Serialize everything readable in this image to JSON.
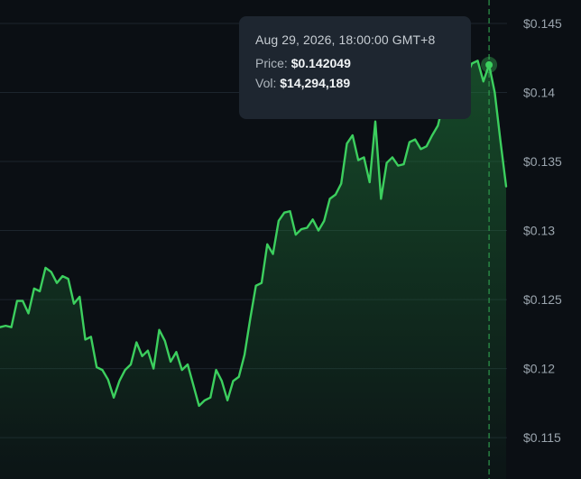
{
  "colors": {
    "background": "#0b0f14",
    "line": "#3ccf5e",
    "area_top": "#1f7a3a",
    "grid": "#1d252d",
    "tooltip_bg": "#1e2630",
    "crosshair": "#2f9a4c"
  },
  "tooltip": {
    "date": "Aug 29, 2026, 18:00:00 GMT+8",
    "price_label": "Price:",
    "price_value": "$0.142049",
    "vol_label": "Vol:",
    "vol_value": "$14,294,189"
  },
  "chart_data": {
    "type": "area",
    "ylim": [
      0.112,
      0.1467
    ],
    "y_ticks": [
      0.115,
      0.12,
      0.125,
      0.13,
      0.135,
      0.14,
      0.145
    ],
    "y_tick_labels": [
      "$0.115",
      "$0.12",
      "$0.125",
      "$0.13",
      "$0.135",
      "$0.14",
      "$0.145"
    ],
    "grid": true,
    "highlight_index": 86,
    "series": [
      {
        "values": [
          0.123,
          0.1231,
          0.123,
          0.1249,
          0.1249,
          0.124,
          0.1258,
          0.1256,
          0.1273,
          0.127,
          0.1262,
          0.1267,
          0.1265,
          0.1247,
          0.1252,
          0.1221,
          0.1223,
          0.1201,
          0.1199,
          0.1192,
          0.1179,
          0.1191,
          0.1199,
          0.1203,
          0.1219,
          0.1209,
          0.1213,
          0.12,
          0.1228,
          0.122,
          0.1205,
          0.1212,
          0.1199,
          0.1203,
          0.1188,
          0.1173,
          0.1177,
          0.1179,
          0.1199,
          0.1191,
          0.1177,
          0.1191,
          0.1194,
          0.121,
          0.1236,
          0.126,
          0.1262,
          0.129,
          0.1283,
          0.1307,
          0.1313,
          0.1314,
          0.1297,
          0.1301,
          0.1302,
          0.1308,
          0.13,
          0.1307,
          0.1323,
          0.1326,
          0.1334,
          0.1363,
          0.1369,
          0.1351,
          0.1353,
          0.1335,
          0.1379,
          0.1323,
          0.1349,
          0.1353,
          0.1347,
          0.1348,
          0.1364,
          0.1366,
          0.1359,
          0.1361,
          0.1369,
          0.1376,
          0.1393,
          0.141,
          0.1401,
          0.1397,
          0.1412,
          0.1421,
          0.1423,
          0.1408,
          0.142,
          0.14,
          0.1365,
          0.1332
        ]
      }
    ]
  }
}
